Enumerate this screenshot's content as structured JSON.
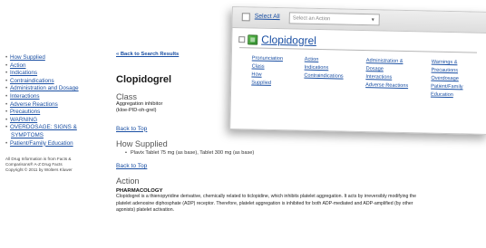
{
  "left_nav": {
    "items": [
      {
        "label": "How Supplied",
        "indent": false
      },
      {
        "label": "Action",
        "indent": false
      },
      {
        "label": "Indications",
        "indent": false
      },
      {
        "label": "Contraindications",
        "indent": false
      },
      {
        "label": "Administration and Dosage",
        "indent": false
      },
      {
        "label": "Interactions",
        "indent": false
      },
      {
        "label": "Adverse Reactions",
        "indent": false
      },
      {
        "label": "Precautions",
        "indent": false
      },
      {
        "label": "WARNING",
        "indent": false
      },
      {
        "label": "OVERDOSAGE: SIGNS &",
        "indent": false
      },
      {
        "label": "SYMPTOMS",
        "indent": true
      },
      {
        "label": "Patient/Family Education",
        "indent": false
      }
    ],
    "note_lines": [
      "All Drug Information is from Facts &",
      "Comparisons® A-Z Drug Facts",
      "Copyright © 2011 by Wolters Kluwer"
    ]
  },
  "main": {
    "back_to_search": "« Back to Search Results",
    "title": "Clopidogrel",
    "class_heading": "Class",
    "class_lines": [
      "Aggregation inhibitor",
      "(kloe-PID-oh-grel)"
    ],
    "back_to_top": "Back to Top",
    "how_supplied_heading": "How Supplied",
    "supplied_items": [
      "Plavix Tablet 75 mg (as base), Tablet 300 mg (as base)"
    ],
    "action_heading": "Action",
    "pharmacology_heading": "PHARMACOLOGY",
    "pharmacology_text": "Clopidogrel is a thienopyridine derivative, chemically related to ticlopidine, which inhibits platelet aggregation. It acts by irreversibly modifying the platelet adenosine diphosphate (ADP) receptor. Therefore, platelet aggregation is inhibited for both ADP-mediated and ADP-amplified (by other agonists) platelet activation."
  },
  "popup": {
    "select_all": "Select All",
    "action_placeholder": "Select an Action",
    "title": "Clopidogrel",
    "icon": "drug-monograph-icon",
    "link_columns": [
      [
        "Pronunciation",
        "Class",
        "How",
        "Supplied"
      ],
      [
        "Action",
        "Indications",
        "Contraindications"
      ],
      [
        "Administration &",
        "Dosage",
        "Interactions",
        "Adverse Reactions"
      ],
      [
        "Warnings &",
        "Precautions",
        "Overdosage",
        "Patient/Family",
        "Education"
      ]
    ]
  },
  "colors": {
    "link": "#1a4fa3",
    "icon_green": "#3aa335"
  }
}
